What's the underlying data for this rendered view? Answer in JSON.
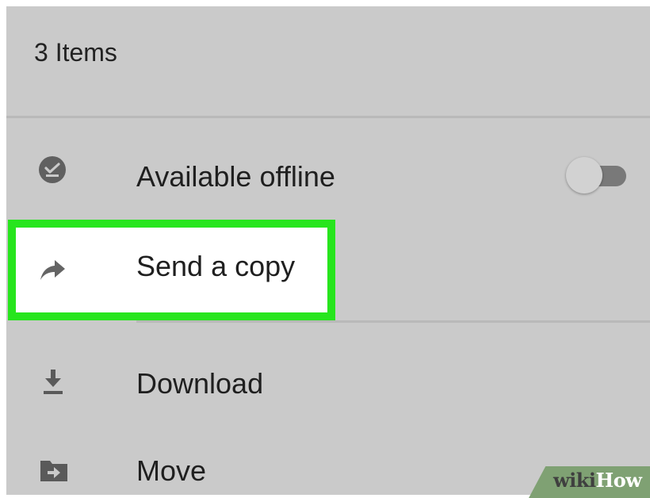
{
  "header": {
    "title": "3 Items"
  },
  "menu": {
    "available_offline": {
      "label": "Available offline",
      "icon": "offline-check-icon",
      "toggle_on": false
    },
    "send_a_copy": {
      "label": "Send a copy",
      "icon": "share-arrow-icon"
    },
    "download": {
      "label": "Download",
      "icon": "download-icon"
    },
    "move": {
      "label": "Move",
      "icon": "move-folder-icon"
    }
  },
  "highlight": {
    "color": "#27e51d"
  },
  "watermark": {
    "part1": "wiki",
    "part2": "How"
  }
}
